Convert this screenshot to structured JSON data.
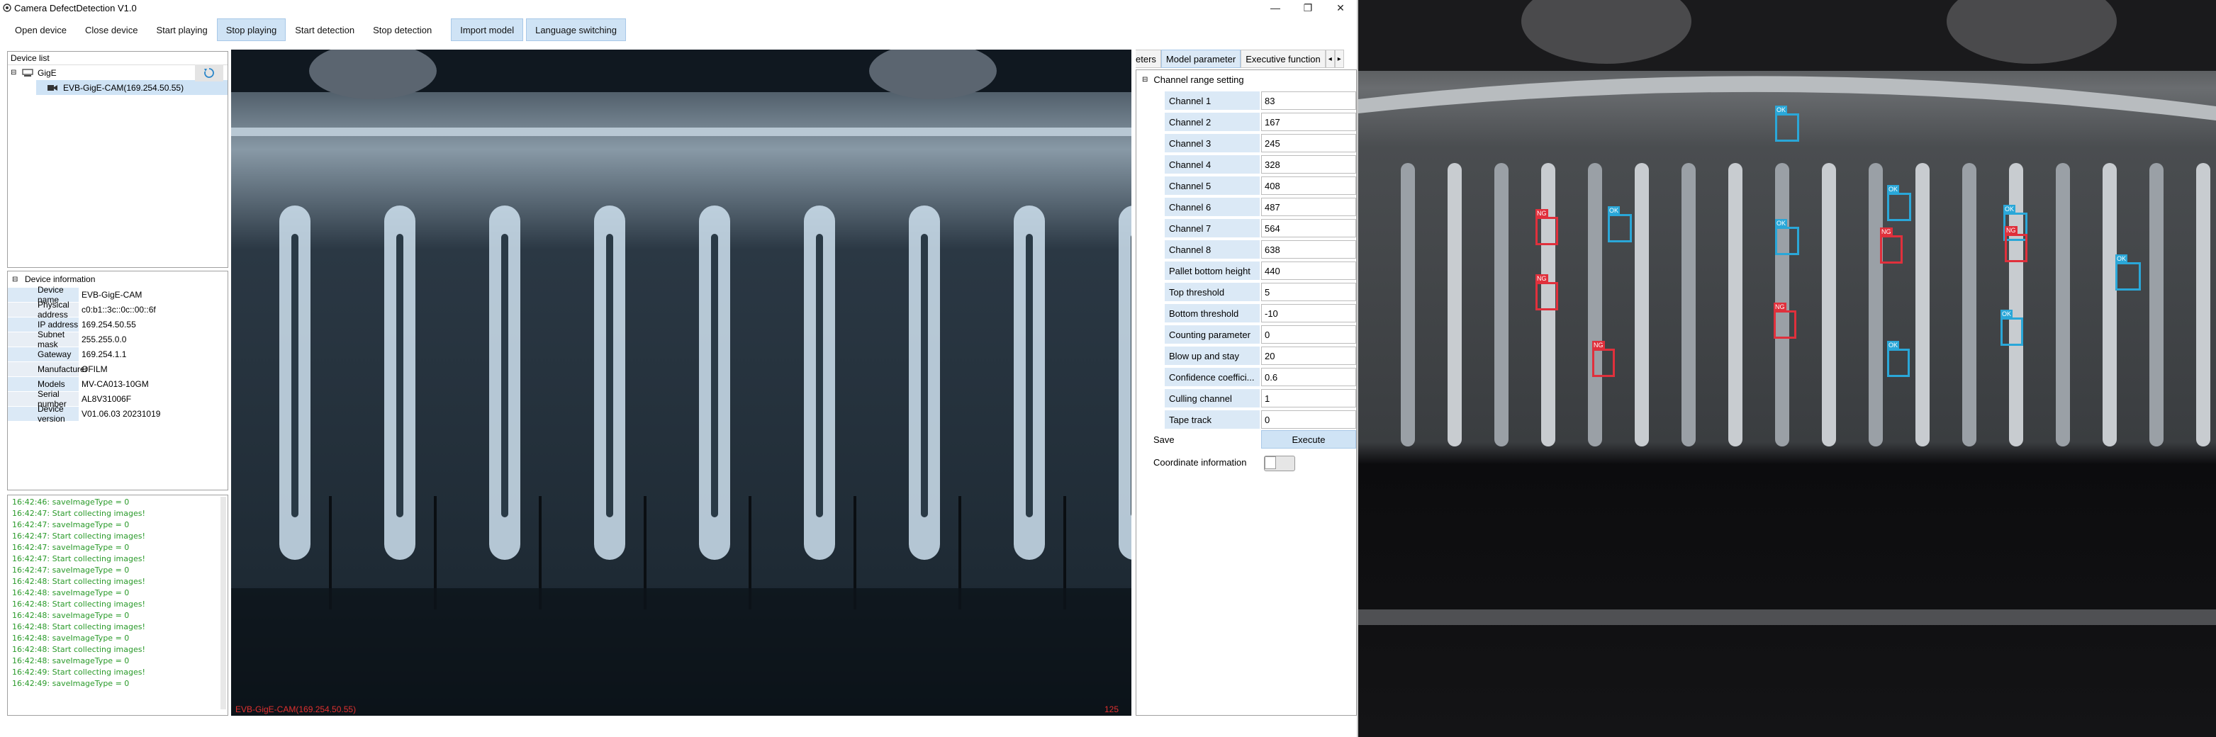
{
  "window": {
    "title": "Camera DefectDetection V1.0",
    "minimize": "—",
    "maximize": "❐",
    "close": "✕"
  },
  "toolbar": {
    "open_device": "Open device",
    "close_device": "Close device",
    "start_playing": "Start playing",
    "stop_playing": "Stop playing",
    "start_detection": "Start detection",
    "stop_detection": "Stop detection",
    "import_model": "Import model",
    "language_switching": "Language switching"
  },
  "device_list": {
    "header": "Device list",
    "group": "GigE",
    "device": "EVB-GigE-CAM(169.254.50.55)"
  },
  "device_info": {
    "header": "Device information",
    "rows": [
      {
        "k": "Device name",
        "v": "EVB-GigE-CAM"
      },
      {
        "k": "Physical address",
        "v": "c0:b1::3c::0c::00::6f"
      },
      {
        "k": "IP address",
        "v": "169.254.50.55"
      },
      {
        "k": "Subnet mask",
        "v": "255.255.0.0"
      },
      {
        "k": "Gateway",
        "v": "169.254.1.1"
      },
      {
        "k": "Manufacturer",
        "v": "OFILM"
      },
      {
        "k": "Models",
        "v": "MV-CA013-10GM"
      },
      {
        "k": "Serial number",
        "v": "AL8V31006F"
      },
      {
        "k": "Device version",
        "v": "V01.06.03 20231019"
      }
    ]
  },
  "log": [
    "16:42:46: saveImageType = 0",
    "16:42:47: Start collecting images!",
    "16:42:47: saveImageType = 0",
    "16:42:47: Start collecting images!",
    "16:42:47: saveImageType = 0",
    "16:42:47: Start collecting images!",
    "16:42:47: saveImageType = 0",
    "16:42:48: Start collecting images!",
    "16:42:48: saveImageType = 0",
    "16:42:48: Start collecting images!",
    "16:42:48: saveImageType = 0",
    "16:42:48: Start collecting images!",
    "16:42:48: saveImageType = 0",
    "16:42:48: Start collecting images!",
    "16:42:48: saveImageType = 0",
    "16:42:49: Start collecting images!",
    "16:42:49: saveImageType = 0"
  ],
  "video": {
    "camera_label": "EVB-GigE-CAM(169.254.50.55)",
    "frame_count": "125"
  },
  "tabs": {
    "partial": "eters",
    "model_parameter": "Model parameter",
    "executive_function": "Executive function",
    "scroll_left": "◂",
    "scroll_right": "▸"
  },
  "params": {
    "section": "Channel range setting",
    "rows": [
      {
        "k": "Channel 1",
        "v": "83"
      },
      {
        "k": "Channel 2",
        "v": "167"
      },
      {
        "k": "Channel 3",
        "v": "245"
      },
      {
        "k": "Channel 4",
        "v": "328"
      },
      {
        "k": "Channel 5",
        "v": "408"
      },
      {
        "k": "Channel 6",
        "v": "487"
      },
      {
        "k": "Channel 7",
        "v": "564"
      },
      {
        "k": "Channel 8",
        "v": "638"
      },
      {
        "k": "Pallet bottom height",
        "v": "440"
      },
      {
        "k": "Top threshold",
        "v": "5"
      },
      {
        "k": "Bottom threshold",
        "v": "-10"
      },
      {
        "k": "Counting parameter",
        "v": "0"
      },
      {
        "k": "Blow up and stay",
        "v": "20"
      },
      {
        "k": "Confidence coeffici...",
        "v": "0.6"
      },
      {
        "k": "Culling channel",
        "v": "1"
      },
      {
        "k": "Tape track",
        "v": "0"
      }
    ],
    "save": "Save",
    "execute": "Execute",
    "coord_info": "Coordinate information",
    "coord_toggle_on": false
  },
  "detections": [
    {
      "label": "OK",
      "color": "#2aa7d8"
    },
    {
      "label": "NG",
      "color": "#e0303c"
    }
  ]
}
